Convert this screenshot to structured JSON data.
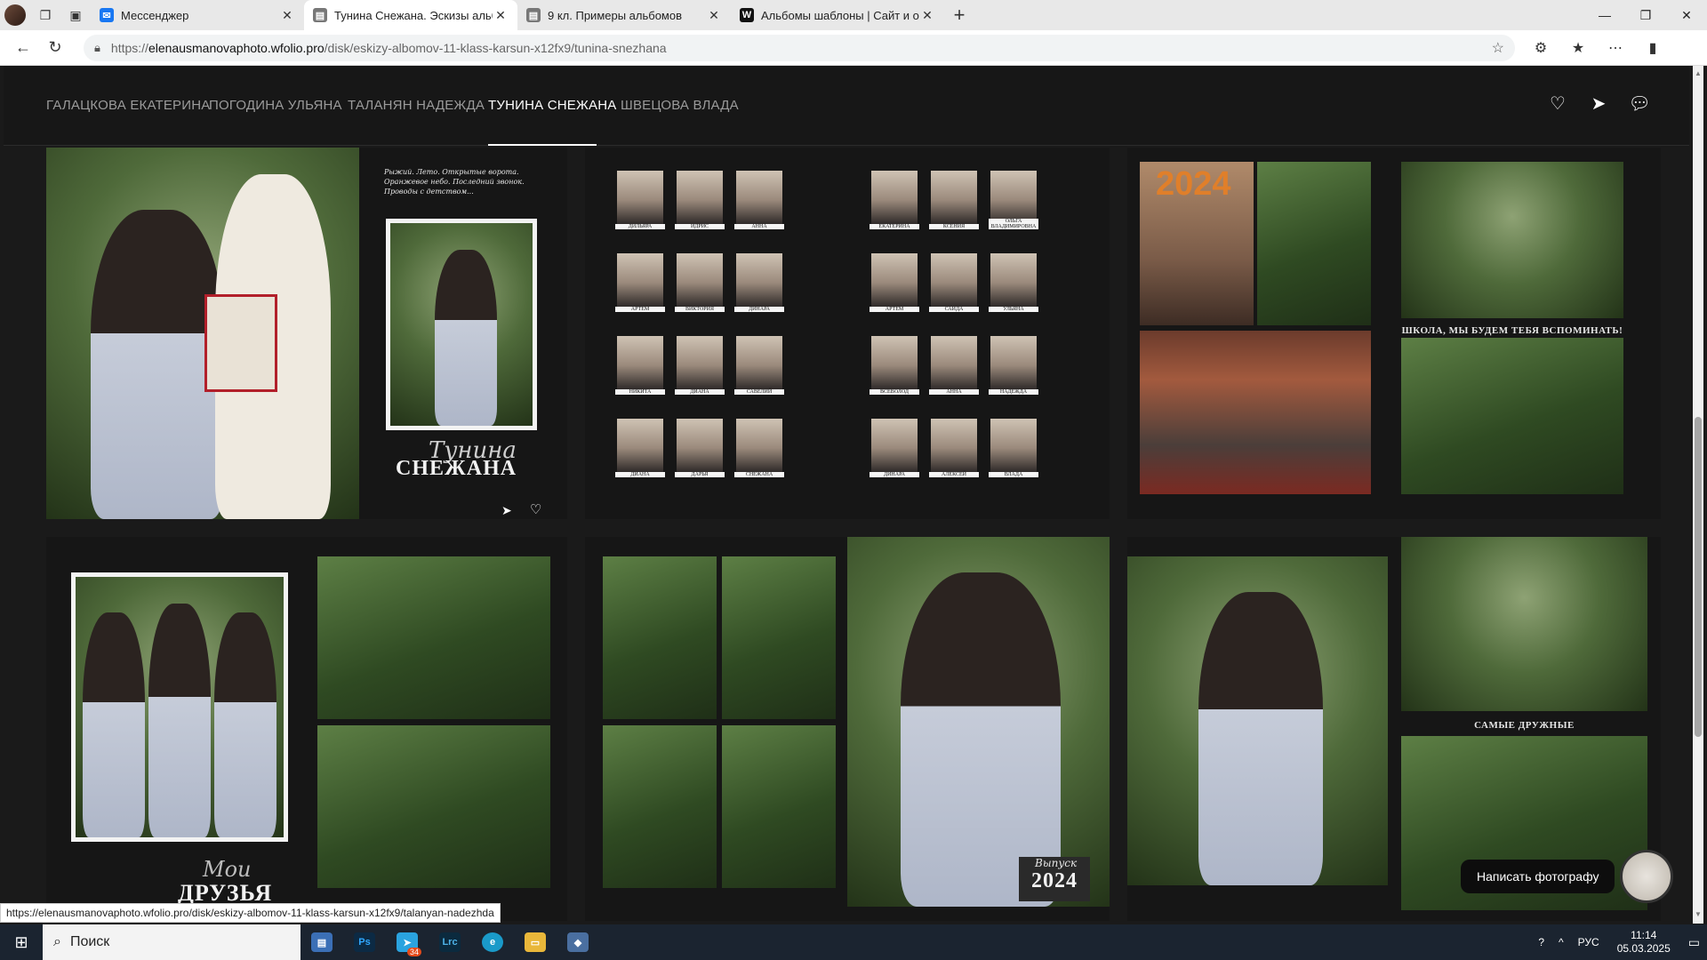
{
  "browser": {
    "tabs": [
      {
        "title": "Мессенджер",
        "favicon": "messenger",
        "color": "#1877f2",
        "active": false
      },
      {
        "title": "Тунина Снежана. Эскизы альбомов",
        "favicon": "page",
        "color": "#555555",
        "active": true
      },
      {
        "title": "9 кл. Примеры альбомов",
        "favicon": "page",
        "color": "#555555",
        "active": false
      },
      {
        "title": "Альбомы шаблоны | Сайт и облако",
        "favicon": "W",
        "color": "#111111",
        "active": false
      }
    ],
    "url_prefix": "https://",
    "url_host": "elenausmanovaphoto.wfolio.pro",
    "url_path": "/disk/eskizy-albomov-11-klass-karsun-x12fx9/tunina-snezhana"
  },
  "site_nav": {
    "items": [
      {
        "label": "ГАЛАЦКОВА ЕКАТЕРИНА",
        "active": false
      },
      {
        "label": "ПОГОДИНА УЛЬЯНА",
        "active": false
      },
      {
        "label": "ТАЛАНЯН НАДЕЖДА",
        "active": false
      },
      {
        "label": "ТУНИНА СНЕЖАНА",
        "active": true
      },
      {
        "label": "ШВЕЦОВА ВЛАДА",
        "active": false
      }
    ],
    "icons": [
      "heart-icon",
      "send-icon",
      "chat-icon"
    ]
  },
  "spread1": {
    "poem": "Рыжий. Лето. Открытые ворота. Оранжевое небо. Последний звонок. Проводы с детством...",
    "script_name": "Тунина",
    "name": "СНЕЖАНА"
  },
  "spread2": {
    "left_names": [
      "ДИЛЬЯРА",
      "ИДРИС",
      "АННА",
      "АРТЕМ",
      "ВИКТОРИЯ",
      "ДИНАРА",
      "НИКИТА",
      "ДИАНА",
      "САВЕЛИЙ",
      "ДИАНА",
      "ДАРЬЯ",
      "СНЕЖАНА"
    ],
    "right_names": [
      "ЕКАТЕРИНА",
      "КСЕНИЯ",
      "ОЛЬГА ВЛАДИМИРОВНА",
      "АРТЕМ",
      "САИДА",
      "УЛЬЯНА",
      "ВСЕВОЛОД",
      "АННА",
      "НАДЕЖДА",
      "ДИНАРА",
      "АЛЕКСЕЙ",
      "ВЛАДА"
    ]
  },
  "spread3": {
    "caption": "ШКОЛА, МЫ БУДЕМ ТЕБЯ ВСПОМИНАТЬ!"
  },
  "spread4": {
    "script": "Мои",
    "title": "ДРУЗЬЯ"
  },
  "spread5": {
    "year_script": "Выпуск",
    "year": "2024"
  },
  "spread6": {
    "caption": "САМЫЕ ДРУЖНЫЕ"
  },
  "status_url": "https://elenausmanovaphoto.wfolio.pro/disk/eskizy-albomov-11-klass-karsun-x12fx9/talanyan-nadezhda",
  "chat_button": "Написать фотографу",
  "taskbar": {
    "search_placeholder": "Поиск",
    "lang": "РУС",
    "time": "11:14",
    "date": "05.03.2025",
    "telegram_badge": "34"
  }
}
